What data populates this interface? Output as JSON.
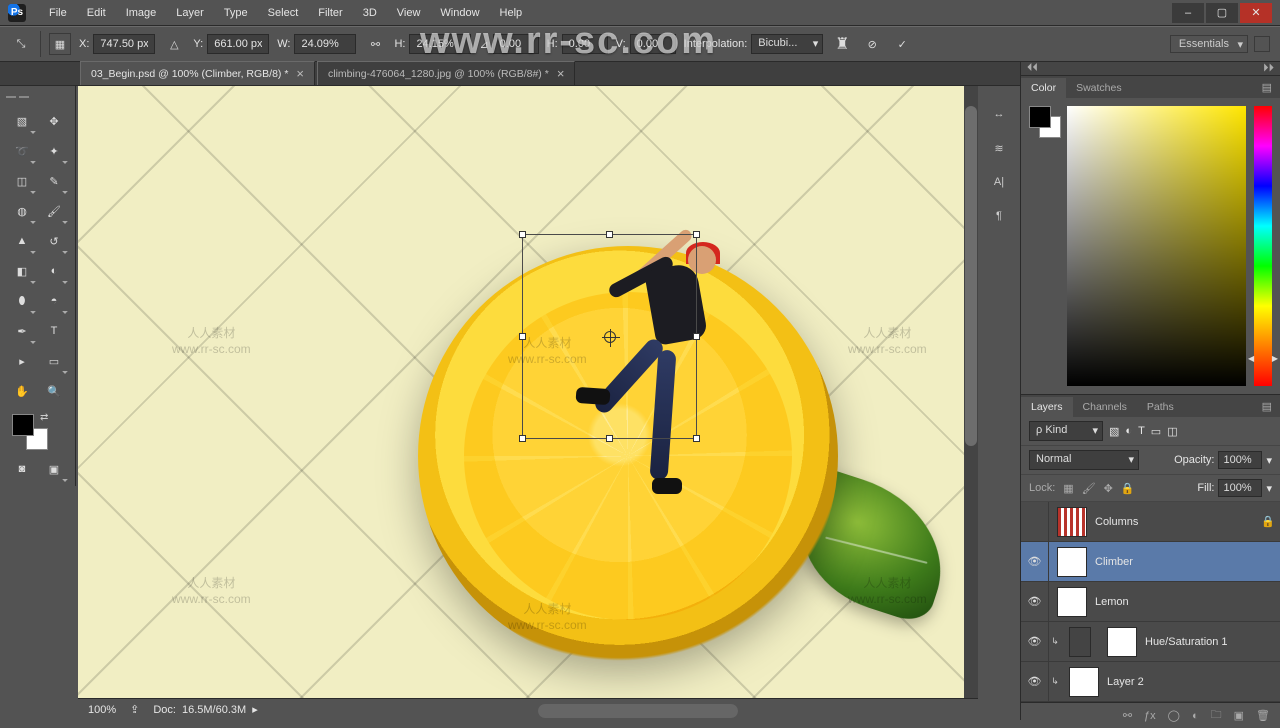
{
  "menu": {
    "items": [
      "File",
      "Edit",
      "Image",
      "Layer",
      "Type",
      "Select",
      "Filter",
      "3D",
      "View",
      "Window",
      "Help"
    ]
  },
  "options": {
    "x_label": "X:",
    "x": "747.50 px",
    "y_label": "Y:",
    "y": "661.00 px",
    "w_label": "W:",
    "w": "24.09%",
    "h_label": "H:",
    "h": "24.15%",
    "rot_label": "⊿",
    "rot": "0.00",
    "hskew_label": "H:",
    "hskew": "0.00",
    "vskew_label": "V:",
    "vskew": "0.00",
    "interp_label": "Interpolation:",
    "interp": "Bicubi..."
  },
  "workspace": {
    "name": "Essentials"
  },
  "tabs": [
    {
      "title": "03_Begin.psd @ 100% (Climber, RGB/8) *",
      "active": true
    },
    {
      "title": "climbing-476064_1280.jpg @ 100% (RGB/8#) *",
      "active": false
    }
  ],
  "status": {
    "zoom": "100%",
    "doc_label": "Doc:",
    "doc": "16.5M/60.3M"
  },
  "watermark": {
    "big": "www.rr-sc.com",
    "cn": "人人素材",
    "url": "www.rr-sc.com"
  },
  "color_panel": {
    "tab1": "Color",
    "tab2": "Swatches"
  },
  "layers_panel": {
    "tab1": "Layers",
    "tab2": "Channels",
    "tab3": "Paths",
    "kind_label": "Kind",
    "kind": "ρ Kind",
    "blend": "Normal",
    "opacity_label": "Opacity:",
    "opacity": "100%",
    "lock_label": "Lock:",
    "fill_label": "Fill:",
    "fill": "100%",
    "layers": [
      {
        "name": "Columns",
        "visible": false,
        "locked": true,
        "thumb": "stripes"
      },
      {
        "name": "Climber",
        "visible": true,
        "selected": true
      },
      {
        "name": "Lemon",
        "visible": true
      },
      {
        "name": "Hue/Saturation 1",
        "visible": true,
        "adjustment": true,
        "clip": true
      },
      {
        "name": "Layer 2",
        "visible": true,
        "clip": true
      }
    ]
  }
}
